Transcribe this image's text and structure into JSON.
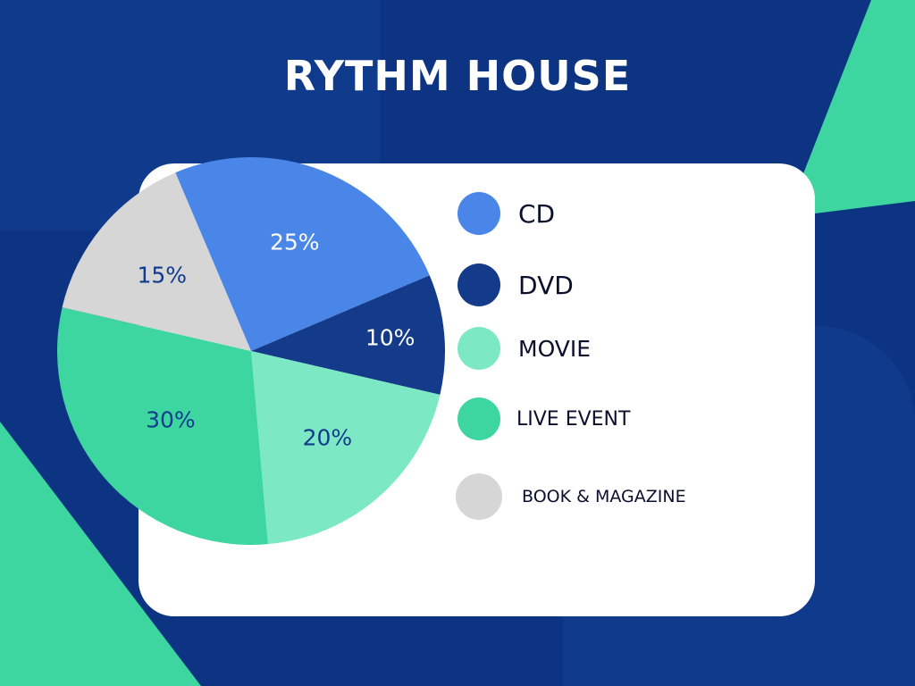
{
  "title": "RYTHM HOUSE",
  "colors": {
    "background": "#0c3482",
    "bg_panel": "#103a8c",
    "accent_green": "#3dd6a0",
    "card": "#ffffff"
  },
  "chart_data": {
    "type": "pie",
    "title": "RYTHM HOUSE",
    "slices": [
      {
        "name": "CD",
        "value": 25,
        "label": "25%",
        "color": "#4a86e8"
      },
      {
        "name": "DVD",
        "value": 10,
        "label": "10%",
        "color": "#143a8a"
      },
      {
        "name": "MOVIE",
        "value": 20,
        "label": "20%",
        "color": "#7de9c4"
      },
      {
        "name": "LIVE EVENT",
        "value": 30,
        "label": "30%",
        "color": "#3dd6a0"
      },
      {
        "name": "BOOK & MAGAZINE",
        "value": 15,
        "label": "15%",
        "color": "#d6d6d6"
      }
    ],
    "legend_position": "right"
  }
}
